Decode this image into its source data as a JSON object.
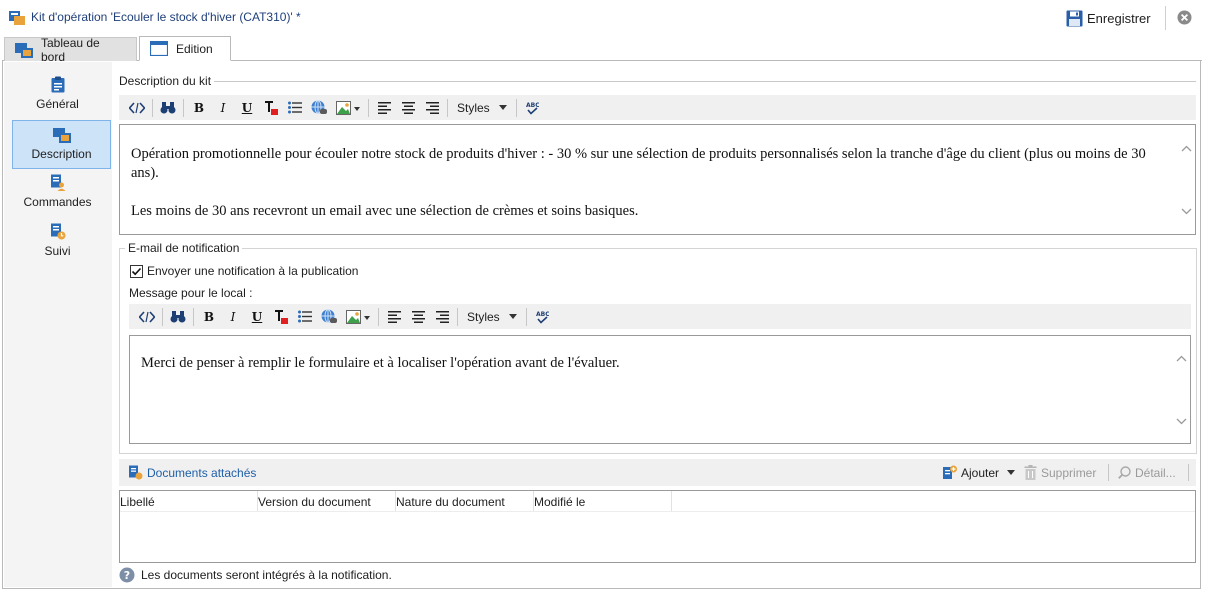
{
  "window": {
    "title": "Kit d'opération 'Ecouler le stock d'hiver (CAT310)' *",
    "save_label": "Enregistrer"
  },
  "tabs": [
    {
      "label": "Tableau de bord",
      "active": false
    },
    {
      "label": "Edition",
      "active": true
    }
  ],
  "sidebar": {
    "items": [
      {
        "label": "Général",
        "icon": "clipboard-icon",
        "active": false
      },
      {
        "label": "Description",
        "icon": "description-icon",
        "active": true
      },
      {
        "label": "Commandes",
        "icon": "orders-icon",
        "active": false
      },
      {
        "label": "Suivi",
        "icon": "tracking-icon",
        "active": false
      }
    ]
  },
  "description": {
    "section_title": "Description du kit",
    "styles_label": "Styles",
    "paragraphs": [
      "Opération promotionnelle pour écouler notre stock de produits d'hiver : - 30 % sur une sélection de produits personnalisés selon la tranche d'âge du client (plus ou moins de 30 ans).",
      "Les moins de 30 ans recevront un email avec une sélection de crèmes et soins basiques."
    ]
  },
  "notification": {
    "section_title": "E-mail de notification",
    "checkbox_label": "Envoyer une notification à la publication",
    "checkbox_checked": true,
    "message_label": "Message pour le local :",
    "styles_label": "Styles",
    "message_text": "Merci de penser à remplir le formulaire et à localiser l'opération avant de l'évaluer."
  },
  "documents": {
    "title": "Documents attachés",
    "add_label": "Ajouter",
    "delete_label": "Supprimer",
    "detail_label": "Détail...",
    "columns": [
      "Libellé",
      "Version du document",
      "Nature du document",
      "Modifié le"
    ],
    "rows": [],
    "footer_note": "Les documents seront intégrés à la notification."
  },
  "colors": {
    "title_text": "#1f3f7a",
    "link_blue": "#1f5fa8",
    "active_nav_bg": "#cde3f7",
    "active_nav_border": "#7eb4ea",
    "toolbar_bg": "#f0f0f0"
  }
}
